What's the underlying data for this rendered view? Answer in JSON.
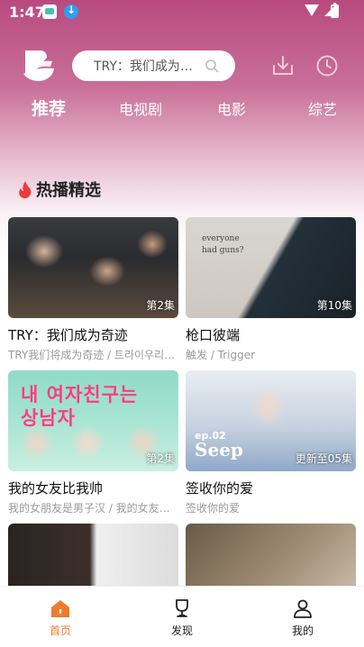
{
  "status_bar": {
    "time": "1:47"
  },
  "header": {
    "search_placeholder": "TRY：我们成为…"
  },
  "tabs": [
    {
      "label": "推荐",
      "active": true
    },
    {
      "label": "电视剧",
      "active": false
    },
    {
      "label": "电影",
      "active": false
    },
    {
      "label": "综艺",
      "active": false
    }
  ],
  "section": {
    "title": "热播精选"
  },
  "cards": [
    {
      "title": "TRY：我们成为奇迹",
      "subtitle": "TRY我们将成为奇迹 / 트라이우리는…",
      "badge": "第2集"
    },
    {
      "title": "枪口彼端",
      "subtitle": "触发 / Trigger",
      "badge": "第10集",
      "poster_text": "everyone\nhad guns?"
    },
    {
      "title": "我的女友比我帅",
      "subtitle": "我的女朋友是男子汉 / 我的女友是…",
      "badge": "第2集",
      "poster_text": "내 여자친구는\n상남자"
    },
    {
      "title": "签收你的爱",
      "subtitle": "签收你的爱",
      "badge": "更新至05集",
      "poster_ep": "ep.02",
      "poster_title": "Seep"
    },
    {
      "title": "",
      "subtitle": "",
      "badge": ""
    },
    {
      "title": "",
      "subtitle": "",
      "badge": ""
    }
  ],
  "bottom_nav": [
    {
      "label": "首页",
      "icon": "home-icon",
      "active": true
    },
    {
      "label": "发现",
      "icon": "trophy-icon",
      "active": false
    },
    {
      "label": "我的",
      "icon": "person-icon",
      "active": false
    }
  ],
  "colors": {
    "accent": "#f07b2c",
    "header_gradient_top": "#b84a7f",
    "flame": "#ee3a3a"
  }
}
